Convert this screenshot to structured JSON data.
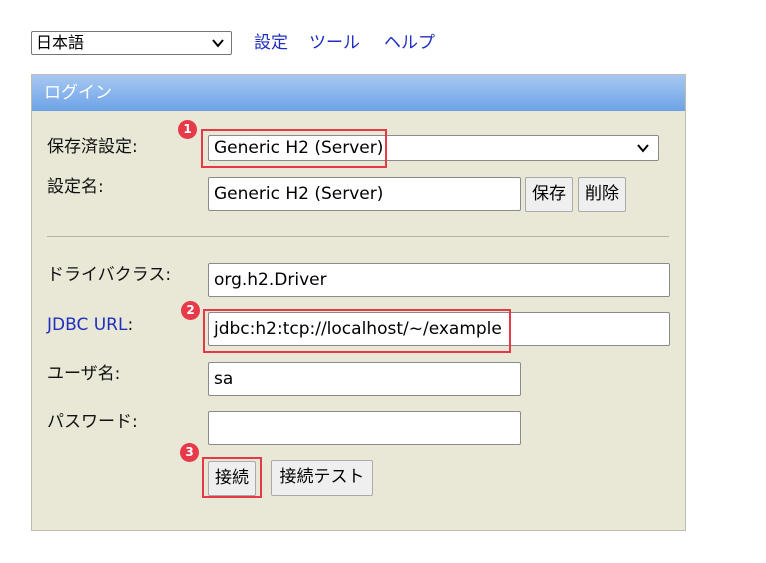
{
  "top_bar": {
    "language_selected": "日本語",
    "links": [
      "設定",
      "ツール",
      "ヘルプ"
    ]
  },
  "panel": {
    "title": "ログイン",
    "saved_settings": {
      "label": "保存済設定:",
      "selected": "Generic H2 (Server)"
    },
    "setting_name": {
      "label": "設定名:",
      "value": "Generic H2 (Server)",
      "save_label": "保存",
      "delete_label": "削除"
    },
    "driver_class": {
      "label": "ドライバクラス:",
      "value": "org.h2.Driver"
    },
    "jdbc_url": {
      "label": "JDBC URL",
      "colon": ":",
      "value": "jdbc:h2:tcp://localhost/~/example"
    },
    "username": {
      "label": "ユーザ名:",
      "value": "sa"
    },
    "password": {
      "label": "パスワード:",
      "value": ""
    },
    "connect_label": "接続",
    "test_connection_label": "接続テスト"
  },
  "annotations": {
    "markers": [
      "1",
      "2",
      "3"
    ],
    "accent_color": "#e53947"
  },
  "colors": {
    "link": "#1f2fc0",
    "panel_background": "#e9e7d6",
    "header_gradient_top": "#a7c8f2",
    "header_gradient_bottom": "#6ea2e7"
  }
}
